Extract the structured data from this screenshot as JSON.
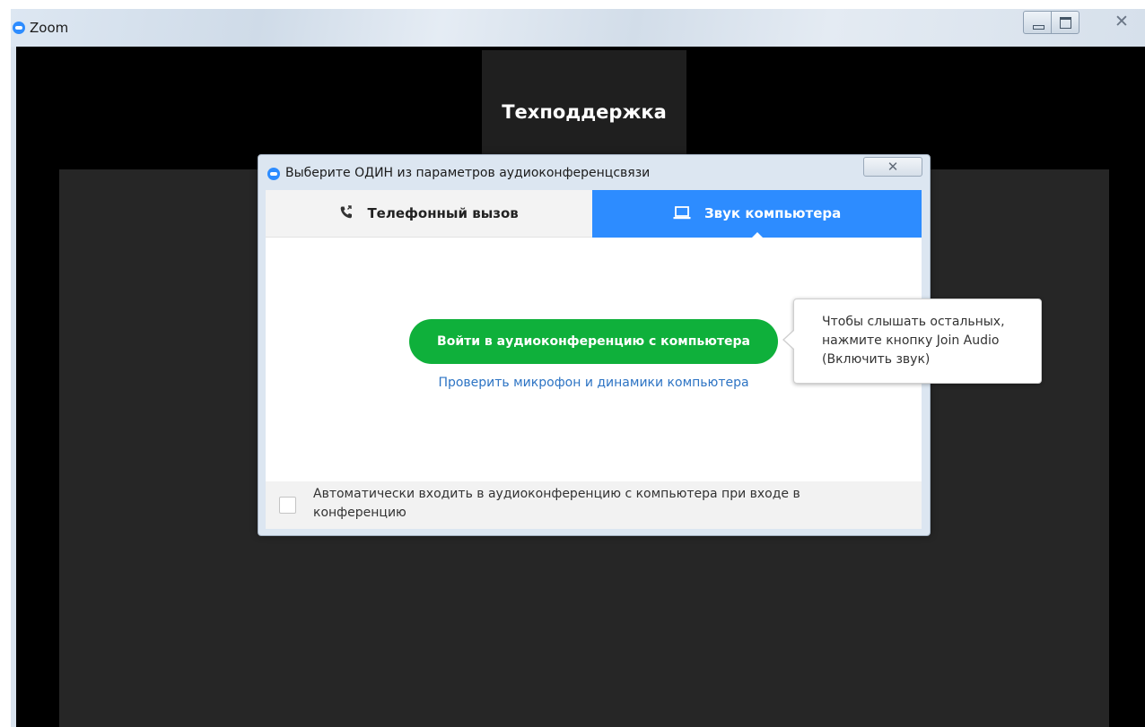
{
  "window": {
    "title": "Zoom"
  },
  "meeting": {
    "participant_name": "Техподдержка"
  },
  "dialog": {
    "title": "Выберите ОДИН из параметров аудиоконференцсвязи",
    "close_glyph": "✕",
    "tabs": [
      {
        "label": "Телефонный вызов",
        "icon": "phone-icon",
        "selected": false
      },
      {
        "label": "Звук компьютера",
        "icon": "laptop-icon",
        "selected": true
      }
    ],
    "join_button_label": "Войти в аудиоконференцию с компьютера",
    "test_link_label": "Проверить микрофон и динамики компьютера",
    "auto_join_label": "Автоматически входить в аудиоконференцию с компьютера при входе в конференцию",
    "auto_join_checked": false
  },
  "tooltip": {
    "text": "Чтобы слышать остальных, нажмите кнопку Join Audio (Включить звук)"
  },
  "colors": {
    "zoom_blue": "#2d8cff",
    "join_green": "#0fb03b",
    "link_blue": "#2d74c4"
  }
}
